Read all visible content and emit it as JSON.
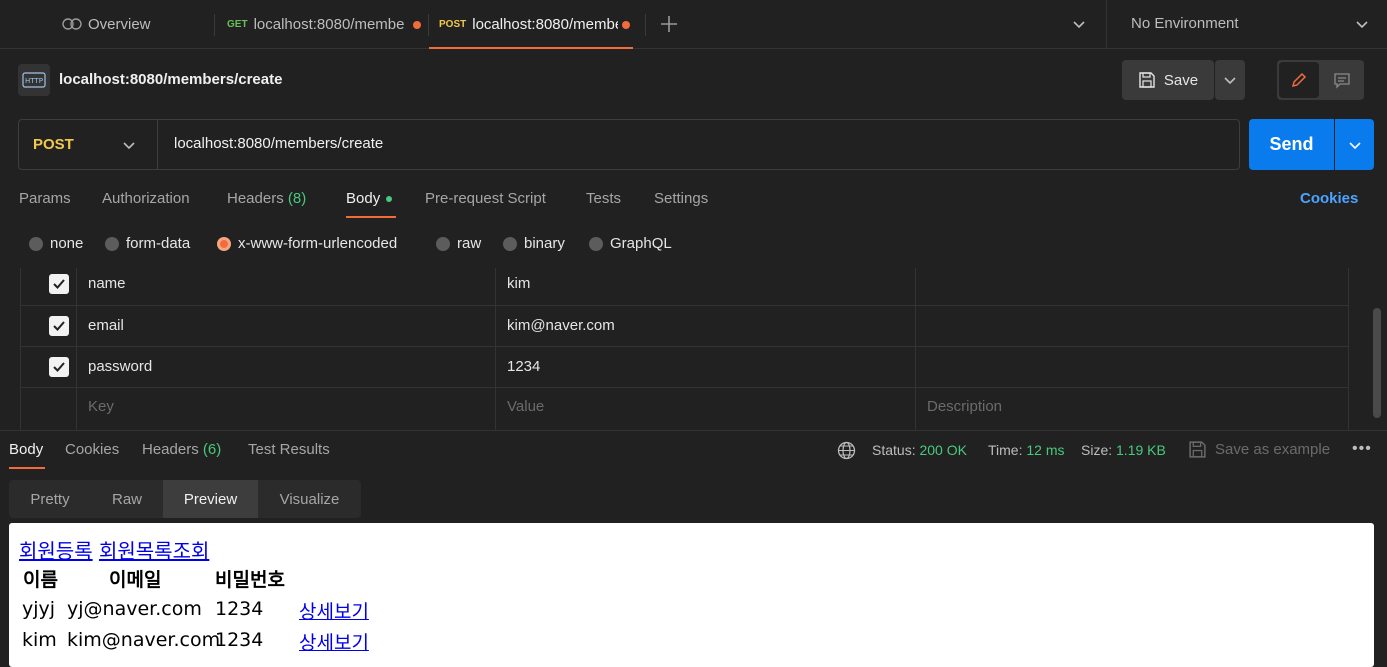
{
  "tabs": [
    {
      "label": "Overview"
    },
    {
      "method": "GET",
      "label": "localhost:8080/membe"
    },
    {
      "method": "POST",
      "label": "localhost:8080/membe"
    }
  ],
  "environment": "No Environment",
  "request": {
    "title": "localhost:8080/members/create",
    "save_label": "Save",
    "method": "POST",
    "url": "localhost:8080/members/create",
    "send_label": "Send"
  },
  "req_tabs": {
    "params": "Params",
    "authorization": "Authorization",
    "headers": "Headers",
    "headers_count": "(8)",
    "body": "Body",
    "pre_request": "Pre-request Script",
    "tests": "Tests",
    "settings": "Settings",
    "cookies": "Cookies"
  },
  "body_types": [
    "none",
    "form-data",
    "x-www-form-urlencoded",
    "raw",
    "binary",
    "GraphQL"
  ],
  "body_rows": [
    {
      "key": "name",
      "value": "kim"
    },
    {
      "key": "email",
      "value": "kim@naver.com"
    },
    {
      "key": "password",
      "value": "1234"
    }
  ],
  "placeholders": {
    "key": "Key",
    "value": "Value",
    "description": "Description"
  },
  "response": {
    "tabs": {
      "body": "Body",
      "cookies": "Cookies",
      "headers": "Headers",
      "headers_count": "(6)",
      "test_results": "Test Results"
    },
    "status_label": "Status:",
    "status_value": "200 OK",
    "time_label": "Time:",
    "time_value": "12 ms",
    "size_label": "Size:",
    "size_value": "1.19 KB",
    "save_example": "Save as example",
    "views": [
      "Pretty",
      "Raw",
      "Preview",
      "Visualize"
    ]
  },
  "preview": {
    "links": [
      "회원등록",
      "회원목록조회"
    ],
    "headers": [
      "이름",
      "이메일",
      "비밀번호"
    ],
    "rows": [
      {
        "name": "yjyj",
        "email": "yj@naver.com",
        "password": "1234",
        "link": "상세보기"
      },
      {
        "name": "kim",
        "email": "kim@naver.com",
        "password": "1234",
        "link": "상세보기"
      }
    ]
  },
  "colors": {
    "accent": "#f26b3a",
    "send": "#097bed",
    "status_ok": "#49c97c",
    "post": "#f2c94c"
  }
}
